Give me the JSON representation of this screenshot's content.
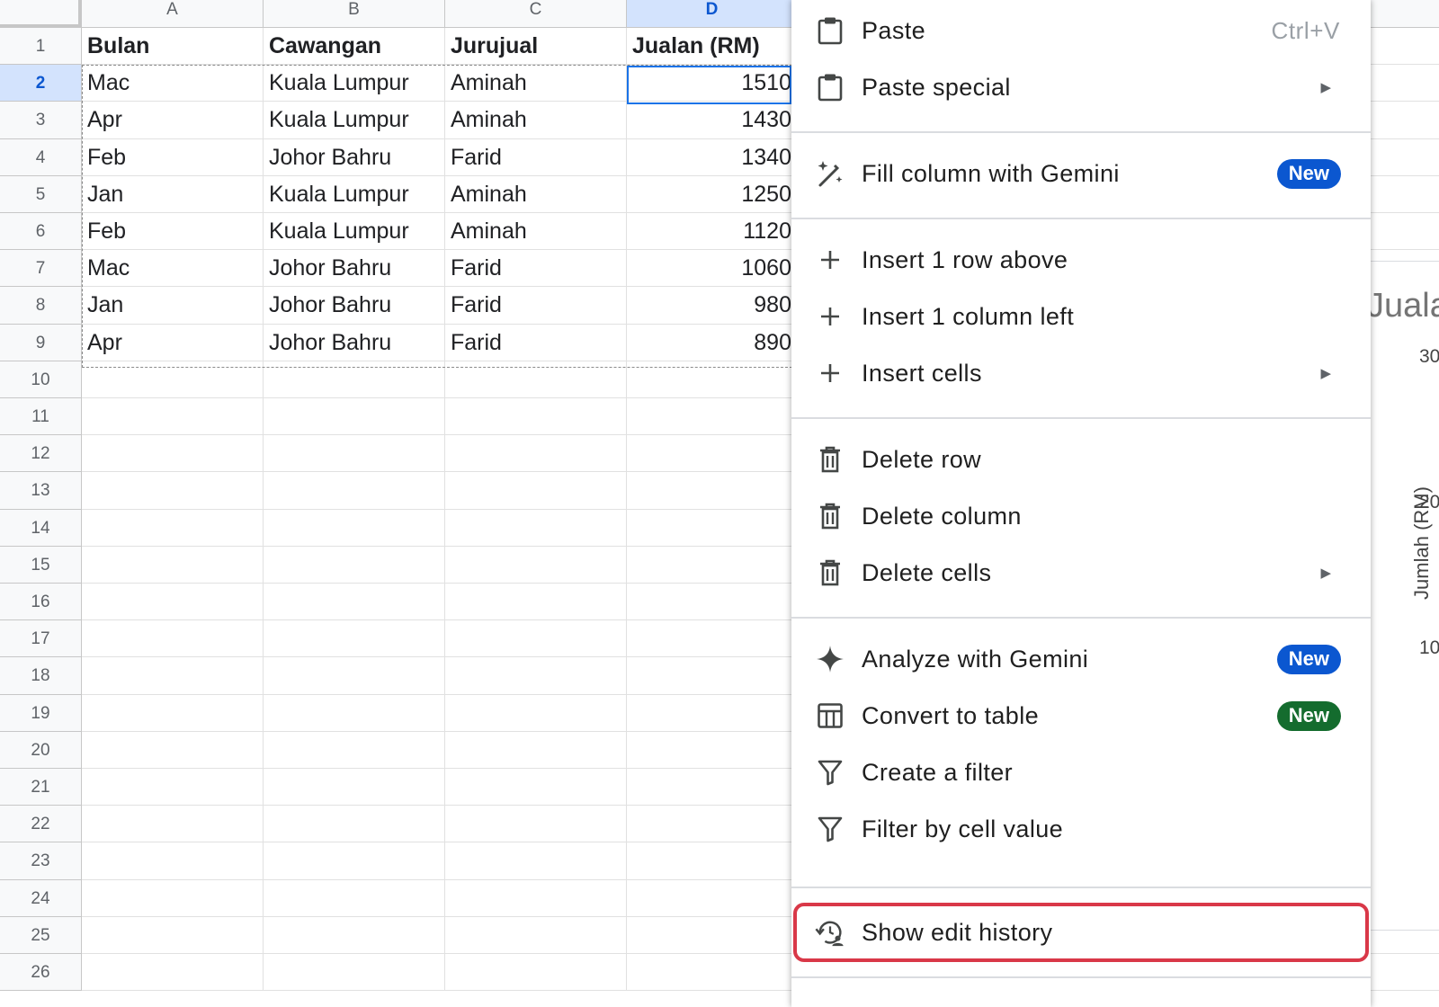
{
  "sheet": {
    "columns": [
      "A",
      "B",
      "C",
      "D"
    ],
    "selected_column": "D",
    "row_numbers": [
      "1",
      "2",
      "3",
      "4",
      "5",
      "6",
      "7",
      "8",
      "9",
      "10",
      "11",
      "12",
      "13",
      "14",
      "15",
      "16",
      "17",
      "18",
      "19",
      "20",
      "21",
      "22",
      "23",
      "24",
      "25",
      "26"
    ],
    "selected_row": "2",
    "header": [
      "Bulan",
      "Cawangan",
      "Jurujual",
      "Jualan (RM)"
    ],
    "rows": [
      [
        "Mac",
        "Kuala Lumpur",
        "Aminah",
        "1510"
      ],
      [
        "Apr",
        "Kuala Lumpur",
        "Aminah",
        "1430"
      ],
      [
        "Feb",
        "Johor Bahru",
        "Farid",
        "1340"
      ],
      [
        "Jan",
        "Kuala Lumpur",
        "Aminah",
        "1250"
      ],
      [
        "Feb",
        "Kuala Lumpur",
        "Aminah",
        "1120"
      ],
      [
        "Mac",
        "Johor Bahru",
        "Farid",
        "1060"
      ],
      [
        "Jan",
        "Johor Bahru",
        "Farid",
        "980"
      ],
      [
        "Apr",
        "Johor Bahru",
        "Farid",
        "890"
      ]
    ]
  },
  "chart_fragment": {
    "title_partial": "Juala",
    "ylabel_partial": "Jumlah (RM)",
    "ticks_partial": [
      "30",
      "20",
      "10"
    ]
  },
  "context_menu": {
    "items": [
      {
        "id": "paste",
        "label": "Paste",
        "icon": "clipboard-icon",
        "shortcut": "Ctrl+V"
      },
      {
        "id": "paste-special",
        "label": "Paste special",
        "icon": "clipboard-icon",
        "submenu": true
      },
      {
        "id": "fill-column-gemini",
        "label": "Fill column with Gemini",
        "icon": "magic-wand-icon",
        "badge": "New",
        "badge_color": "#0b57d0"
      },
      {
        "id": "insert-row-above",
        "label": "Insert 1 row above",
        "icon": "plus-icon"
      },
      {
        "id": "insert-column-left",
        "label": "Insert 1 column left",
        "icon": "plus-icon"
      },
      {
        "id": "insert-cells",
        "label": "Insert cells",
        "icon": "plus-icon",
        "submenu": true
      },
      {
        "id": "delete-row",
        "label": "Delete row",
        "icon": "trash-icon"
      },
      {
        "id": "delete-column",
        "label": "Delete column",
        "icon": "trash-icon"
      },
      {
        "id": "delete-cells",
        "label": "Delete cells",
        "icon": "trash-icon",
        "submenu": true
      },
      {
        "id": "analyze-gemini",
        "label": "Analyze with Gemini",
        "icon": "sparkle-icon",
        "badge": "New",
        "badge_color": "#0b57d0"
      },
      {
        "id": "convert-to-table",
        "label": "Convert to table",
        "icon": "table-icon",
        "badge": "New",
        "badge_color": "#146c2e"
      },
      {
        "id": "create-filter",
        "label": "Create a filter",
        "icon": "filter-icon"
      },
      {
        "id": "filter-by-cell-value",
        "label": "Filter by cell value",
        "icon": "filter-icon"
      },
      {
        "id": "show-edit-history",
        "label": "Show edit history",
        "icon": "edit-history-icon",
        "highlighted": true
      }
    ]
  },
  "colors": {
    "selection_blue": "#1a73e8",
    "header_selected_bg": "#d3e3fd",
    "highlight_red": "#d93848",
    "badge_blue": "#0b57d0",
    "badge_green": "#146c2e"
  }
}
